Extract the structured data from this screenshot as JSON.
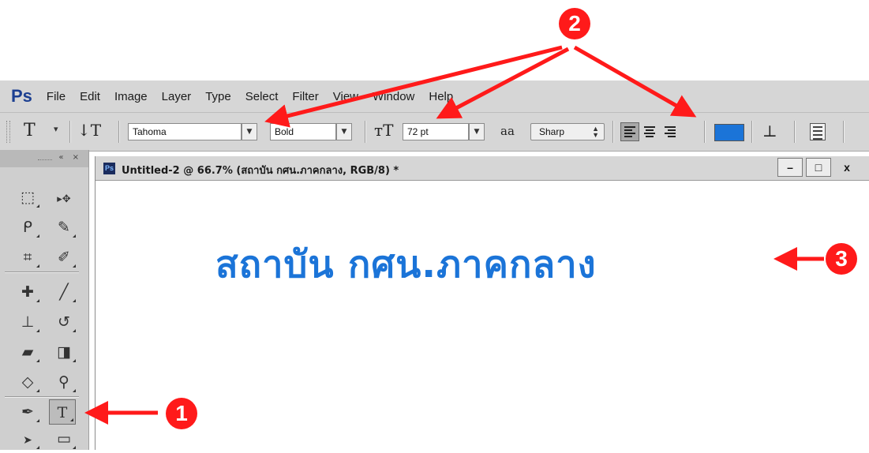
{
  "menubar": {
    "logo": "Ps",
    "items": [
      "File",
      "Edit",
      "Image",
      "Layer",
      "Type",
      "Select",
      "Filter",
      "View",
      "Window",
      "Help"
    ]
  },
  "options_bar": {
    "tool_glyph": "T",
    "orientation_glyph": "↓T",
    "font_family": "Tahoma",
    "font_style": "Bold",
    "size_glyph": "тT",
    "font_size": "72 pt",
    "aa_glyph": "aa",
    "antialias": "Sharp",
    "alignment_selected": "left",
    "text_color": "#1b74d8",
    "warp_glyph": "⊥"
  },
  "toolbar": {
    "header_controls": "« ×",
    "tools": [
      {
        "name": "marquee-tool",
        "glyph": "⬚"
      },
      {
        "name": "move-tool",
        "glyph": "▸✥"
      },
      {
        "name": "lasso-tool",
        "glyph": "ᑭ"
      },
      {
        "name": "quick-selection-tool",
        "glyph": "✎"
      },
      {
        "name": "crop-tool",
        "glyph": "⌗"
      },
      {
        "name": "eyedropper-tool",
        "glyph": "✐"
      },
      {
        "name": "healing-brush-tool",
        "glyph": "✚"
      },
      {
        "name": "brush-tool",
        "glyph": "╱"
      },
      {
        "name": "clone-stamp-tool",
        "glyph": "⊥"
      },
      {
        "name": "history-brush-tool",
        "glyph": "↺"
      },
      {
        "name": "eraser-tool",
        "glyph": "▰"
      },
      {
        "name": "gradient-tool",
        "glyph": "◨"
      },
      {
        "name": "blur-tool",
        "glyph": "◇"
      },
      {
        "name": "dodge-tool",
        "glyph": "⚲"
      },
      {
        "name": "pen-tool",
        "glyph": "✒"
      },
      {
        "name": "type-tool",
        "glyph": "T"
      },
      {
        "name": "path-selection-tool",
        "glyph": "➤"
      },
      {
        "name": "rectangle-tool",
        "glyph": "▭"
      }
    ]
  },
  "document": {
    "ps_badge": "Ps",
    "title": "Untitled-2 @ 66.7% (สถาบัน กศน.ภาคกลาง, RGB/8) *",
    "window_buttons": [
      "–",
      "□",
      "x"
    ],
    "canvas_text": "สถาบัน กศน.ภาคกลาง"
  },
  "annotations": {
    "badge1": "1",
    "badge2": "2",
    "badge3": "3",
    "arrow_color": "#ff1a1a"
  }
}
